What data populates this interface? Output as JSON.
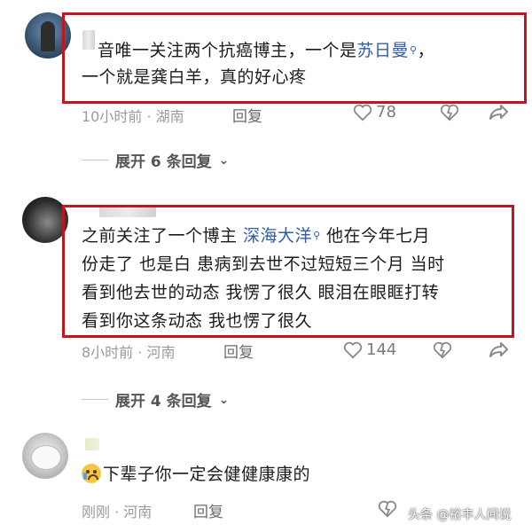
{
  "comments": [
    {
      "text_line1_prefix": "音唯一关注两个抗癌博主，一个是",
      "tag": "苏日曼",
      "text_line1_suffix": "，",
      "text_line2": "一个就是龚白羊，真的好心疼",
      "meta": "10小时前 · 湖南",
      "reply": "回复",
      "likes": "78",
      "expand": "展开 6 条回复"
    },
    {
      "text_line1_prefix": "之前关注了一个博主 ",
      "tag": "深海大洋",
      "text_line1_suffix": " 他在今年七月",
      "text_line2": "份走了 也是白 患病到去世不过短短三个月 当时",
      "text_line3": "看到他去世的动态 我愣了很久 眼泪在眼眶打转",
      "text_line4": "看到你这条动态 我也愣了很久",
      "meta": "8小时前 · 河南",
      "reply": "回复",
      "likes": "144",
      "expand": "展开 4 条回复"
    },
    {
      "text": "下辈子你一定会健健康康的",
      "emoji": "crying-face",
      "meta": "刚刚 · 河南",
      "reply": "回复"
    }
  ],
  "watermark": "头条 @裕丰人间说",
  "colors": {
    "highlight": "#c0161f",
    "tag": "#2f5da8",
    "meta": "#9a9a9a"
  }
}
